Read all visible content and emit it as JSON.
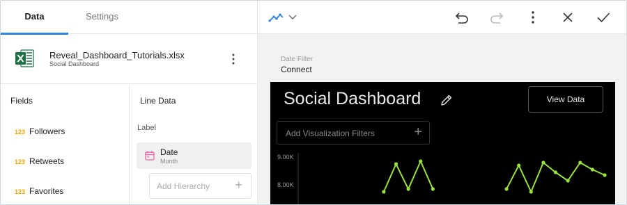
{
  "tabs": [
    {
      "label": "Data",
      "active": true
    },
    {
      "label": "Settings",
      "active": false
    }
  ],
  "file": {
    "name": "Reveal_Dashboard_Tutorials.xlsx",
    "subtitle": "Social Dashboard",
    "icon": "excel-file-icon"
  },
  "fields": {
    "title": "Fields",
    "items": [
      {
        "type_badge": "123",
        "label": "Followers"
      },
      {
        "type_badge": "123",
        "label": "Retweets"
      },
      {
        "type_badge": "123",
        "label": "Favorites"
      }
    ]
  },
  "line_data": {
    "title": "Line Data",
    "label_section": "Label",
    "label_field": {
      "name": "Date",
      "sub": "Month",
      "icon": "calendar-icon"
    },
    "add_hierarchy": "Add Hierarchy"
  },
  "toolbar": {
    "chart_type_icon": "line-chart-icon",
    "icons": [
      "undo-icon",
      "redo-icon",
      "more-vertical-icon",
      "close-icon",
      "check-icon"
    ]
  },
  "date_filter": {
    "label": "Date Filter",
    "value": "Connect"
  },
  "dashboard": {
    "title": "Social Dashboard",
    "view_data_label": "View Data",
    "viz_filter_placeholder": "Add Visualization Filters"
  },
  "colors": {
    "accent": "#2e86de",
    "numeric_badge": "#f0a500",
    "line_series": "#9be23c",
    "calendar": "#e75aa0",
    "excel_green": "#1e7145"
  },
  "chart_data": {
    "type": "line",
    "y_ticks": [
      "9.00K",
      "8.00K"
    ],
    "ylim": [
      7700,
      9200
    ],
    "series": [
      {
        "values": [
          null,
          null,
          null,
          7750,
          8750,
          7850,
          8850,
          7850,
          null,
          null,
          null,
          null,
          null,
          7850,
          8700,
          7750,
          8800,
          8450,
          8150,
          8800,
          8550,
          8350
        ]
      }
    ]
  }
}
